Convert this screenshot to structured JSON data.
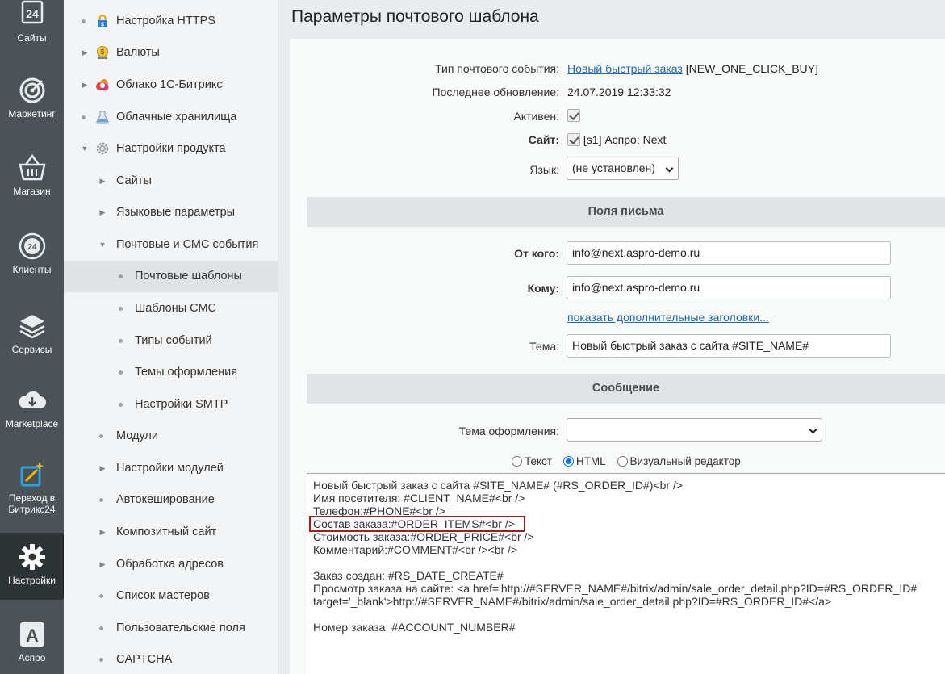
{
  "left_panel": {
    "items": [
      {
        "label": "Сайты",
        "icon": "calendar-24-icon"
      },
      {
        "label": "Маркетинг",
        "icon": "target-icon"
      },
      {
        "label": "Магазин",
        "icon": "basket-icon"
      },
      {
        "label": "Клиенты",
        "icon": "clients-24-icon"
      },
      {
        "label": "Сервисы",
        "icon": "layers-icon"
      },
      {
        "label": "Marketplace",
        "icon": "cloud-download-icon"
      },
      {
        "label": "Переход в Битрикс24",
        "icon": "magic-wand-icon"
      },
      {
        "label": "Настройки",
        "icon": "gear-icon"
      },
      {
        "label": "Аспро",
        "icon": "aspro-a-icon"
      }
    ]
  },
  "menu": {
    "items": [
      {
        "label": "Настройка HTTPS",
        "marker": "dot",
        "icon": "lock-icon",
        "level": 1
      },
      {
        "label": "Валюты",
        "marker": "arrow",
        "icon": "coins-icon",
        "level": 1
      },
      {
        "label": "Облако 1С-Битрикс",
        "marker": "arrow",
        "icon": "cloud-icon",
        "level": 1
      },
      {
        "label": "Облачные хранилища",
        "marker": "dot",
        "icon": "flask-icon",
        "level": 1
      },
      {
        "label": "Настройки продукта",
        "marker": "arrow-down",
        "icon": "gear-icon",
        "level": 1
      },
      {
        "label": "Сайты",
        "marker": "arrow",
        "level": 2
      },
      {
        "label": "Языковые параметры",
        "marker": "arrow",
        "level": 2
      },
      {
        "label": "Почтовые и СМС события",
        "marker": "arrow-down",
        "level": 2
      },
      {
        "label": "Почтовые шаблоны",
        "marker": "dot",
        "level": 3,
        "selected": true
      },
      {
        "label": "Шаблоны СМС",
        "marker": "dot",
        "level": 3
      },
      {
        "label": "Типы событий",
        "marker": "dot",
        "level": 3
      },
      {
        "label": "Темы оформления",
        "marker": "dot",
        "level": 3
      },
      {
        "label": "Настройки SMTP",
        "marker": "dot",
        "level": 3
      },
      {
        "label": "Модули",
        "marker": "dot",
        "level": 2
      },
      {
        "label": "Настройки модулей",
        "marker": "arrow",
        "level": 2
      },
      {
        "label": "Автокеширование",
        "marker": "dot",
        "level": 2
      },
      {
        "label": "Композитный сайт",
        "marker": "arrow",
        "level": 2
      },
      {
        "label": "Обработка адресов",
        "marker": "arrow",
        "level": 2
      },
      {
        "label": "Список мастеров",
        "marker": "dot",
        "level": 2
      },
      {
        "label": "Пользовательские поля",
        "marker": "dot",
        "level": 2
      },
      {
        "label": "CAPTCHA",
        "marker": "dot",
        "level": 2
      }
    ]
  },
  "page": {
    "title": "Параметры почтового шаблона"
  },
  "form": {
    "event_type_label": "Тип почтового события:",
    "event_type_link": "Новый быстрый заказ",
    "event_type_code": "[NEW_ONE_CLICK_BUY]",
    "updated_label": "Последнее обновление:",
    "updated_value": "24.07.2019 12:33:32",
    "active_label": "Активен:",
    "site_label": "Сайт:",
    "site_value": "[s1] Аспро: Next",
    "lang_label": "Язык:",
    "lang_value": "(не установлен)",
    "section_fields": "Поля письма",
    "from_label": "От кого:",
    "from_value": "info@next.aspro-demo.ru",
    "to_label": "Кому:",
    "to_value": "info@next.aspro-demo.ru",
    "extra_headers_link": "показать дополнительные заголовки...",
    "subject_label": "Тема:",
    "subject_value": "Новый быстрый заказ с сайта #SITE_NAME#",
    "section_message": "Сообщение",
    "theme_label": "Тема оформления:",
    "theme_value": "",
    "radio_text": "Текст",
    "radio_html": "HTML",
    "radio_visual": "Визуальный редактор",
    "body_format_selected": "HTML"
  },
  "editor": {
    "lines": [
      "Новый быстрый заказ с сайта #SITE_NAME# (#RS_ORDER_ID#)<br />",
      "Имя посетителя: #CLIENT_NAME#<br />",
      "Телефон:#PHONE#<br />",
      "Состав заказа:#ORDER_ITEMS#<br />",
      "Стоимость заказа:#ORDER_PRICE#<br />",
      "Комментарий:#COMMENT#<br /><br />",
      "",
      "Заказ создан: #RS_DATE_CREATE#",
      "Просмотр заказа на сайте: <a href='http://#SERVER_NAME#/bitrix/admin/sale_order_detail.php?ID=#RS_ORDER_ID#'",
      "target='_blank'>http://#SERVER_NAME#/bitrix/admin/sale_order_detail.php?ID=#RS_ORDER_ID#</a>",
      "",
      "Номер заказа: #ACCOUNT_NUMBER#"
    ],
    "highlighted_line": 3
  }
}
